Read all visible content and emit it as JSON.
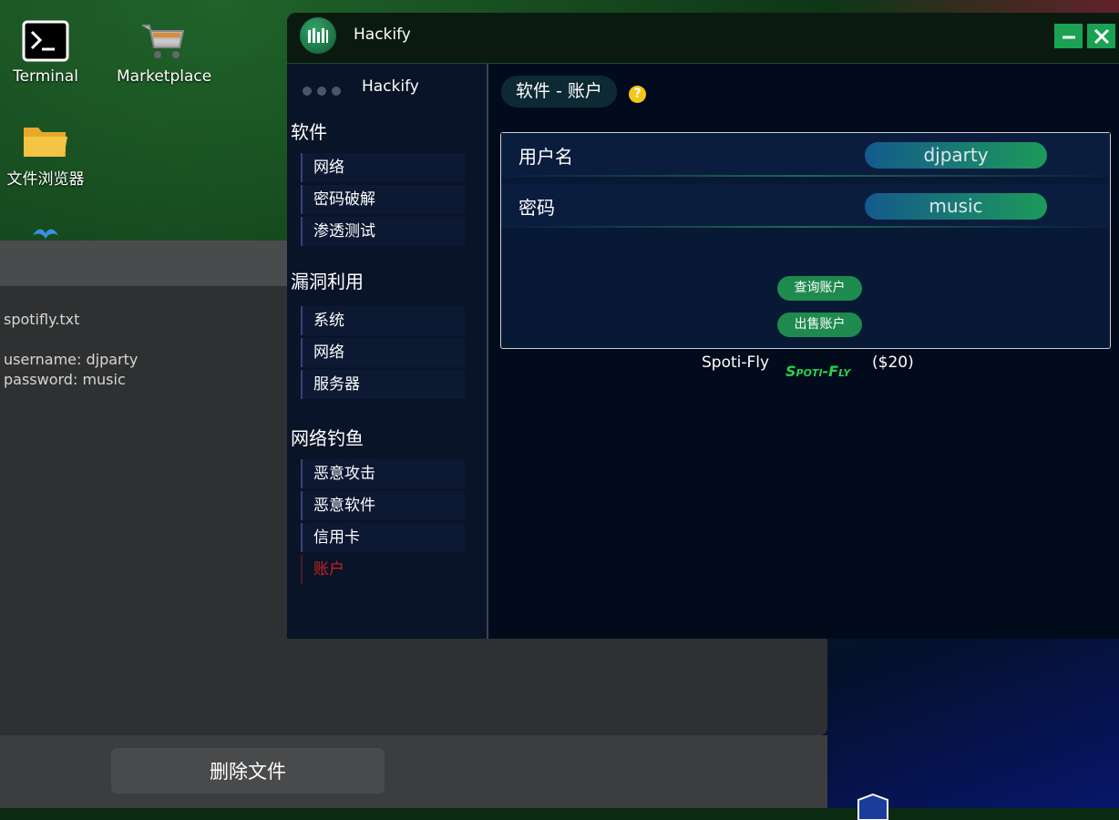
{
  "desktop": {
    "icons": [
      {
        "label": "Terminal"
      },
      {
        "label": "Marketplace"
      },
      {
        "label": "文件浏览器"
      }
    ]
  },
  "file_viewer": {
    "filename": "spotifly.txt",
    "line1": "username: djparty",
    "line2": "password: music",
    "delete_button": "删除文件"
  },
  "hackify": {
    "window_title": "Hackify",
    "sidebar": {
      "app_title": "Hackify",
      "sections": [
        {
          "title": "软件",
          "items": [
            "网络",
            "密码破解",
            "渗透测试"
          ]
        },
        {
          "title": "漏洞利用",
          "items": [
            "系统",
            "网络",
            "服务器"
          ]
        },
        {
          "title": "网络钓鱼",
          "items": [
            "恶意攻击",
            "恶意软件",
            "信用卡",
            "账户"
          ]
        }
      ],
      "active_item": "账户"
    },
    "main": {
      "breadcrumb": "软件 - 账户",
      "help": "?",
      "username_label": "用户名",
      "username_value": "djparty",
      "password_label": "密码",
      "password_value": "music",
      "query_button": "查询账户",
      "sell_button": "出售账户",
      "product_name": "Spoti-Fly",
      "product_logo": "Spoti-Fly",
      "product_price": "($20)"
    }
  },
  "colors": {
    "accent_green": "#1e8a4e",
    "active_red": "#c8211f",
    "help_yellow": "#f5c518"
  }
}
